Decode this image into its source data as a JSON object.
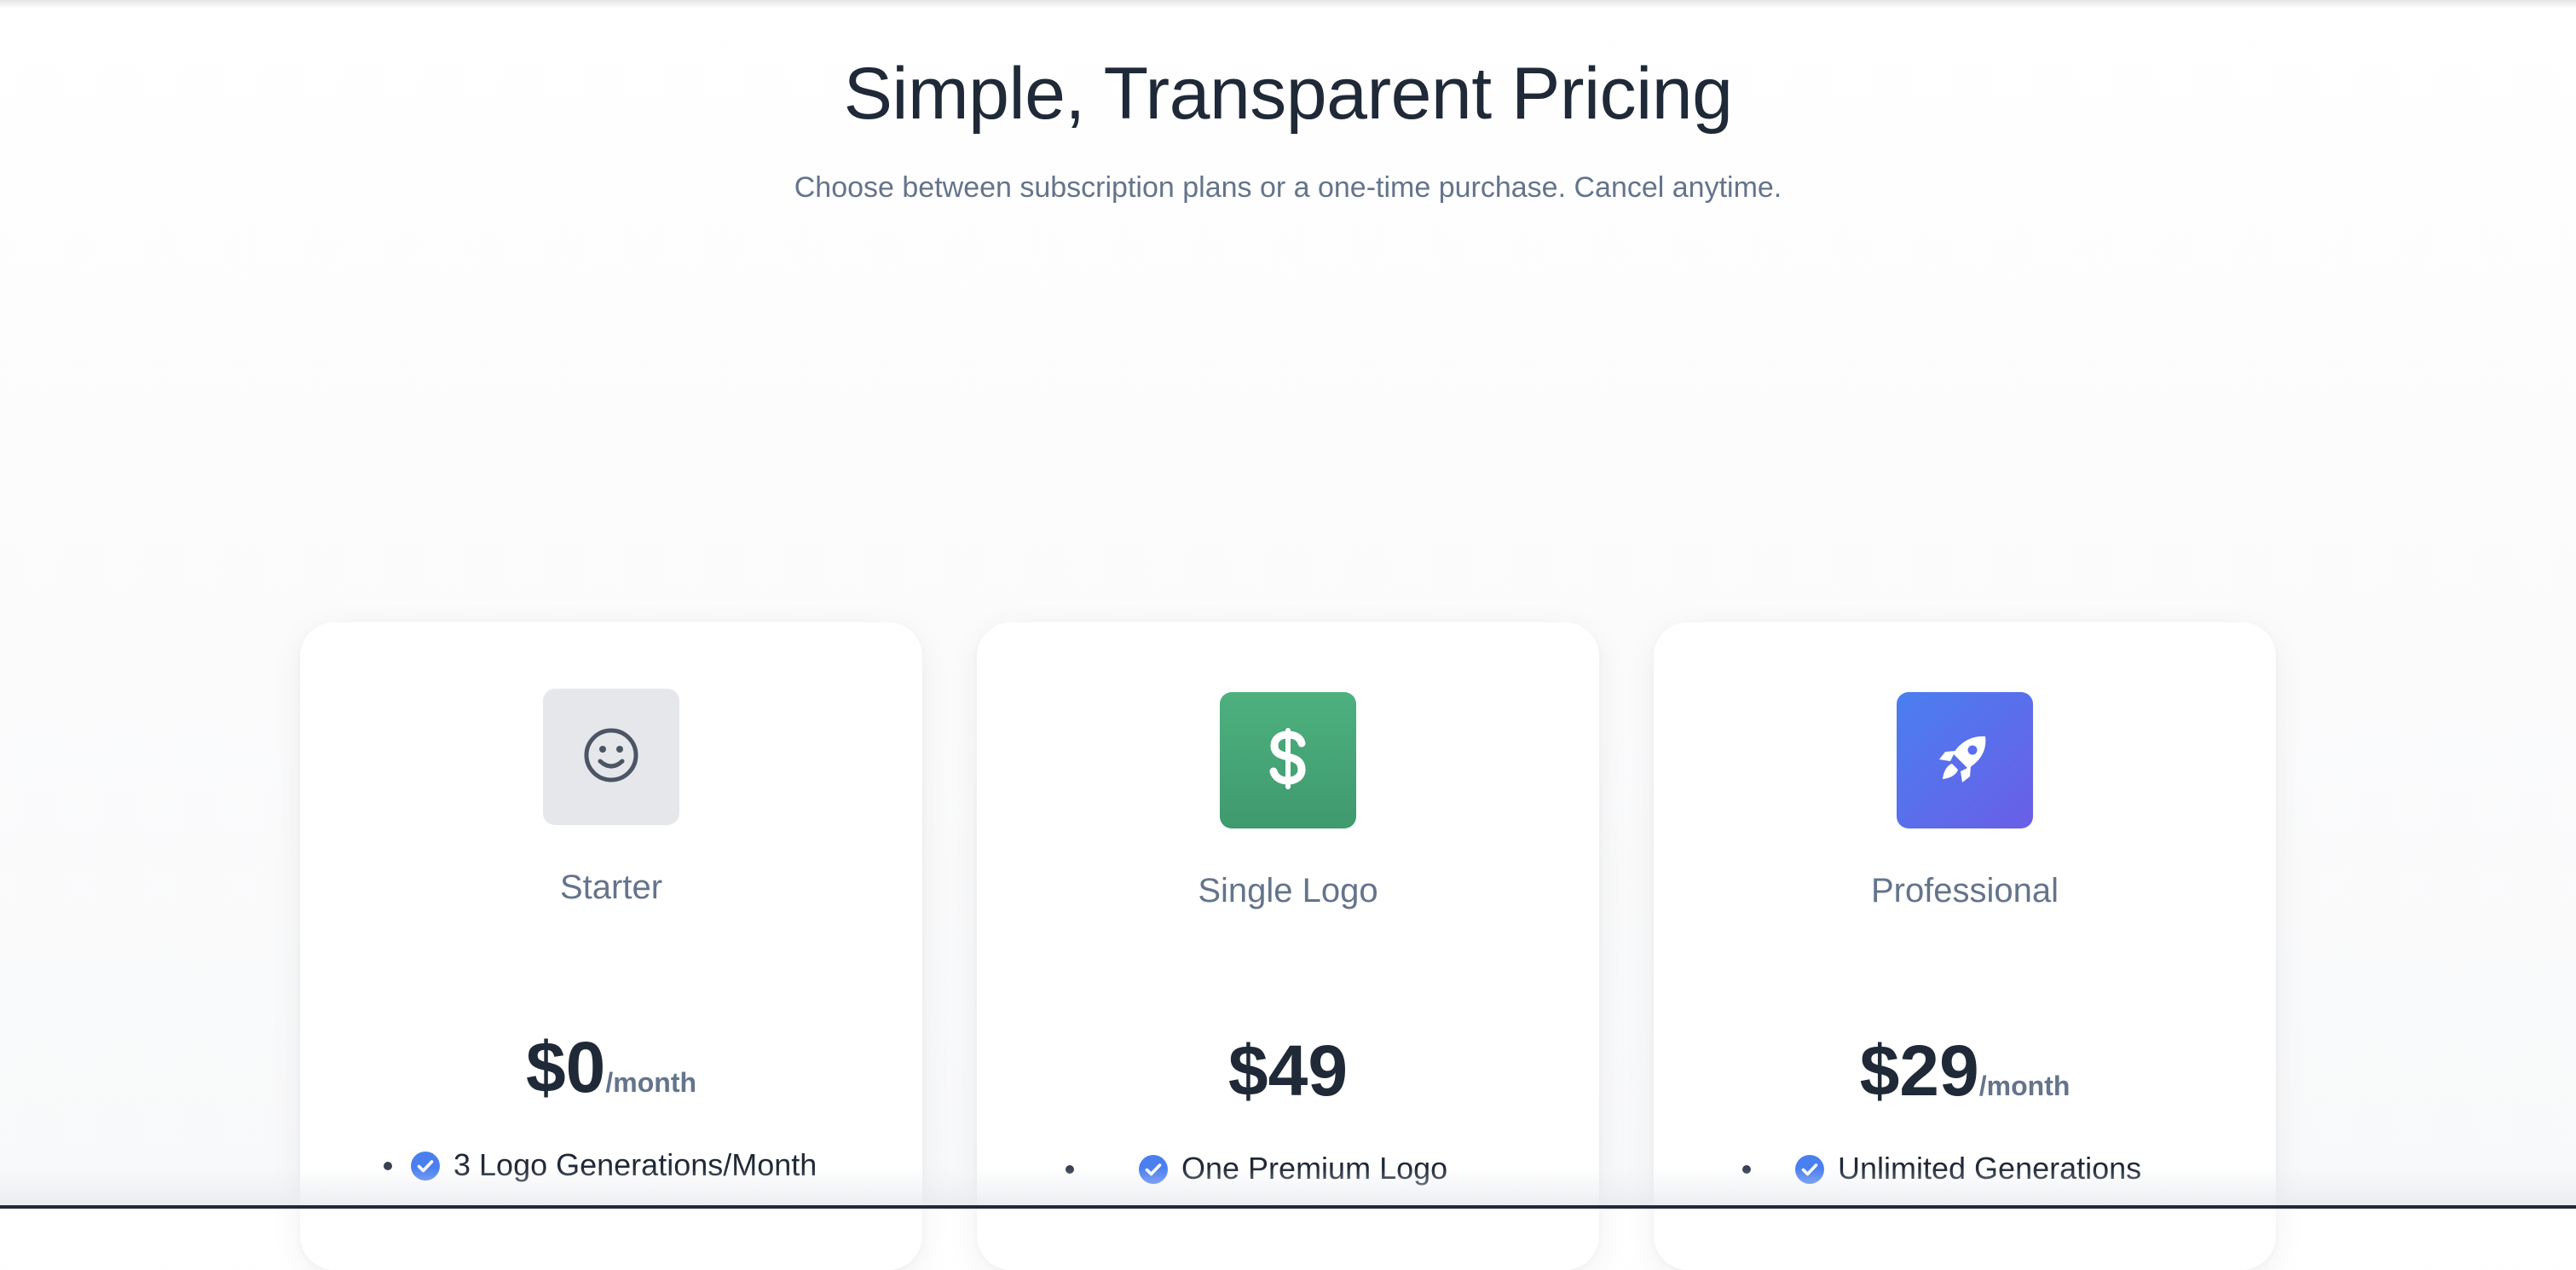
{
  "header": {
    "title": "Simple, Transparent Pricing",
    "subtitle": "Choose between subscription plans or a one-time purchase. Cancel anytime."
  },
  "plans": [
    {
      "icon": "smiley-face-icon",
      "name": "Starter",
      "price": "$0",
      "period": "/month",
      "features": [
        "3 Logo Generations/Month"
      ]
    },
    {
      "icon": "dollar-sign-icon",
      "name": "Single Logo",
      "price": "$49",
      "period": "",
      "features": [
        "One Premium Logo"
      ]
    },
    {
      "icon": "rocket-icon",
      "name": "Professional",
      "price": "$29",
      "period": "/month",
      "features": [
        "Unlimited Generations"
      ]
    }
  ],
  "colors": {
    "text_dark": "#1f2937",
    "text_muted": "#64748b",
    "check_blue": "#4a7ff0",
    "starter_tile": "#e5e7eb",
    "single_logo_tile": "#45a676",
    "professional_tile": "#5b6ef0"
  }
}
